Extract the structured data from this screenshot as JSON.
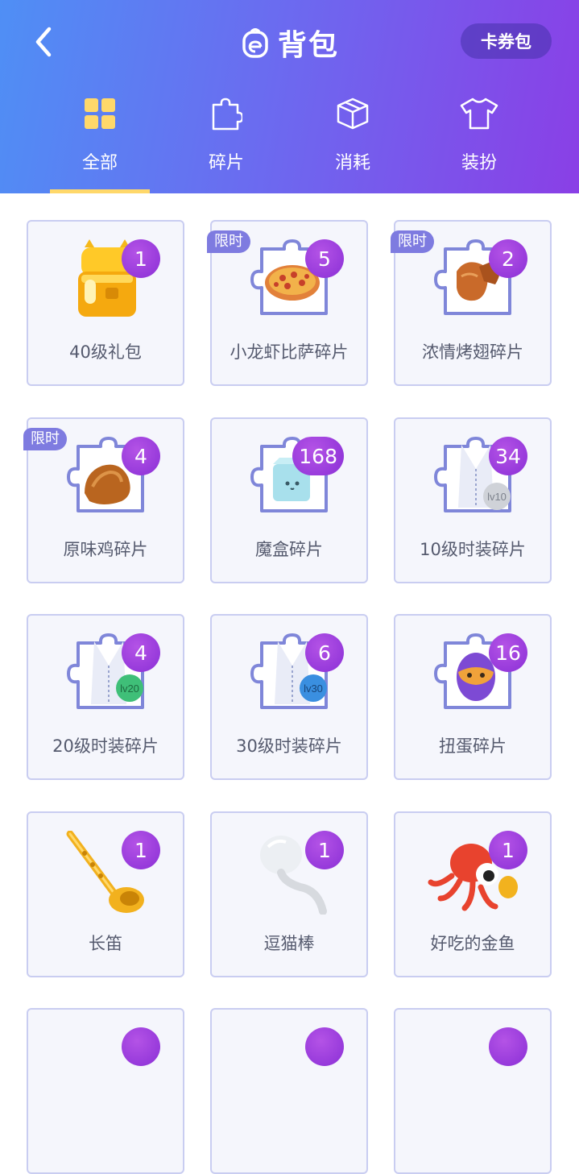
{
  "header": {
    "title": "背包",
    "coupon_button": "卡券包",
    "colors": {
      "gradient_start": "#4f8ff5",
      "gradient_end": "#8a3fe6",
      "indicator": "#ffd86a"
    }
  },
  "tabs": [
    {
      "label": "全部",
      "icon": "grid-icon",
      "active": true
    },
    {
      "label": "碎片",
      "icon": "puzzle-icon",
      "active": false
    },
    {
      "label": "消耗",
      "icon": "box-icon",
      "active": false
    },
    {
      "label": "装扮",
      "icon": "tshirt-icon",
      "active": false
    }
  ],
  "limited_label": "限时",
  "items": [
    {
      "name": "40级礼包",
      "count": "1",
      "limited": false,
      "art": "gift-box"
    },
    {
      "name": "小龙虾比萨碎片",
      "count": "5",
      "limited": true,
      "art": "pizza-fragment"
    },
    {
      "name": "浓情烤翅碎片",
      "count": "2",
      "limited": true,
      "art": "wing-fragment"
    },
    {
      "name": "原味鸡碎片",
      "count": "4",
      "limited": true,
      "art": "chicken-fragment"
    },
    {
      "name": "魔盒碎片",
      "count": "168",
      "limited": false,
      "art": "magic-box-fragment"
    },
    {
      "name": "10级时装碎片",
      "count": "34",
      "limited": false,
      "art": "outfit-fragment",
      "level_tag": "lv10"
    },
    {
      "name": "20级时装碎片",
      "count": "4",
      "limited": false,
      "art": "outfit-fragment",
      "level_tag": "lv20"
    },
    {
      "name": "30级时装碎片",
      "count": "6",
      "limited": false,
      "art": "outfit-fragment",
      "level_tag": "lv30"
    },
    {
      "name": "扭蛋碎片",
      "count": "16",
      "limited": false,
      "art": "egg-fragment"
    },
    {
      "name": "长笛",
      "count": "1",
      "limited": false,
      "art": "flute"
    },
    {
      "name": "逗猫棒",
      "count": "1",
      "limited": false,
      "art": "cat-teaser"
    },
    {
      "name": "好吃的金鱼",
      "count": "1",
      "limited": false,
      "art": "goldfish"
    }
  ]
}
